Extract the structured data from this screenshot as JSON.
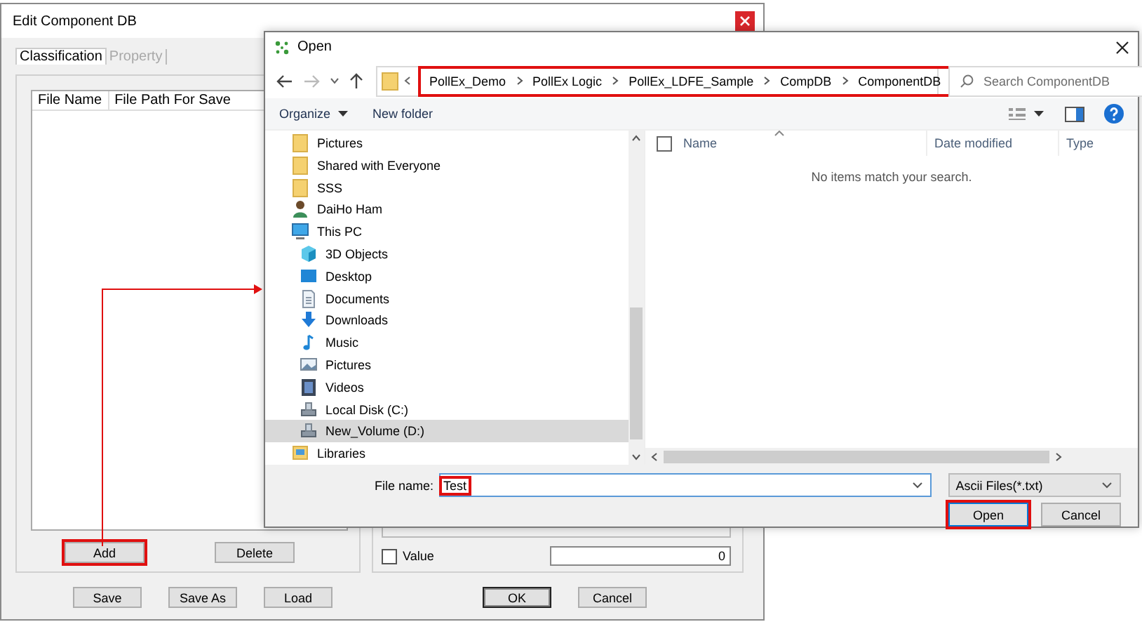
{
  "edit_window": {
    "title": "Edit Component DB",
    "tabs": [
      {
        "label": "Classification",
        "selected": true,
        "disabled": false
      },
      {
        "label": "Property",
        "selected": false,
        "disabled": true
      }
    ],
    "list": {
      "columns": [
        "File Name",
        "File Path For Save"
      ]
    },
    "list_buttons": [
      {
        "label": "Add",
        "highlighted": true
      },
      {
        "label": "Delete",
        "highlighted": false
      }
    ],
    "value_option": {
      "label": "Value",
      "checked": false
    },
    "value_field": "0",
    "buttons": [
      {
        "label": "Save",
        "default": false
      },
      {
        "label": "Save As",
        "default": false
      },
      {
        "label": "Load",
        "default": false
      },
      {
        "label": "OK",
        "default": true
      },
      {
        "label": "Cancel",
        "default": false
      }
    ]
  },
  "open_dialog": {
    "title": "Open",
    "address": {
      "highlighted": true,
      "segments": [
        "PollEx_Demo",
        "PollEx Logic",
        "PollEx_LDFE_Sample",
        "CompDB",
        "ComponentDB"
      ]
    },
    "search": {
      "placeholder": "Search ComponentDB"
    },
    "toolbar": [
      {
        "label": "Organize",
        "kind": "menu"
      },
      {
        "label": "New folder",
        "kind": "button"
      }
    ],
    "nav_tree": [
      {
        "label": "Pictures",
        "kind": "folder",
        "selected": false
      },
      {
        "label": "Shared with Everyone",
        "kind": "folder",
        "selected": false
      },
      {
        "label": "SSS",
        "kind": "folder",
        "selected": false
      },
      {
        "label": "DaiHo Ham",
        "kind": "user",
        "selected": false
      },
      {
        "label": "This PC",
        "kind": "pc",
        "selected": false,
        "children": [
          {
            "label": "3D Objects",
            "kind": "cube",
            "selected": false
          },
          {
            "label": "Desktop",
            "kind": "desktop",
            "selected": false
          },
          {
            "label": "Documents",
            "kind": "document",
            "selected": false
          },
          {
            "label": "Downloads",
            "kind": "download",
            "selected": false
          },
          {
            "label": "Music",
            "kind": "music",
            "selected": false
          },
          {
            "label": "Pictures",
            "kind": "picture",
            "selected": false
          },
          {
            "label": "Videos",
            "kind": "video",
            "selected": false
          },
          {
            "label": "Local Disk (C:)",
            "kind": "drive",
            "selected": false
          },
          {
            "label": "New_Volume (D:)",
            "kind": "drive",
            "selected": true
          }
        ]
      },
      {
        "label": "Libraries",
        "kind": "library",
        "selected": false
      }
    ],
    "columns": [
      "Name",
      "Date modified",
      "Type"
    ],
    "empty_message": "No items match your search.",
    "file_name": {
      "label": "File name:",
      "value": "Test",
      "highlighted": true
    },
    "file_type": "Ascii Files(*.txt)",
    "buttons": [
      {
        "label": "Open",
        "highlighted": true,
        "default": true
      },
      {
        "label": "Cancel",
        "highlighted": false,
        "default": false
      }
    ]
  }
}
